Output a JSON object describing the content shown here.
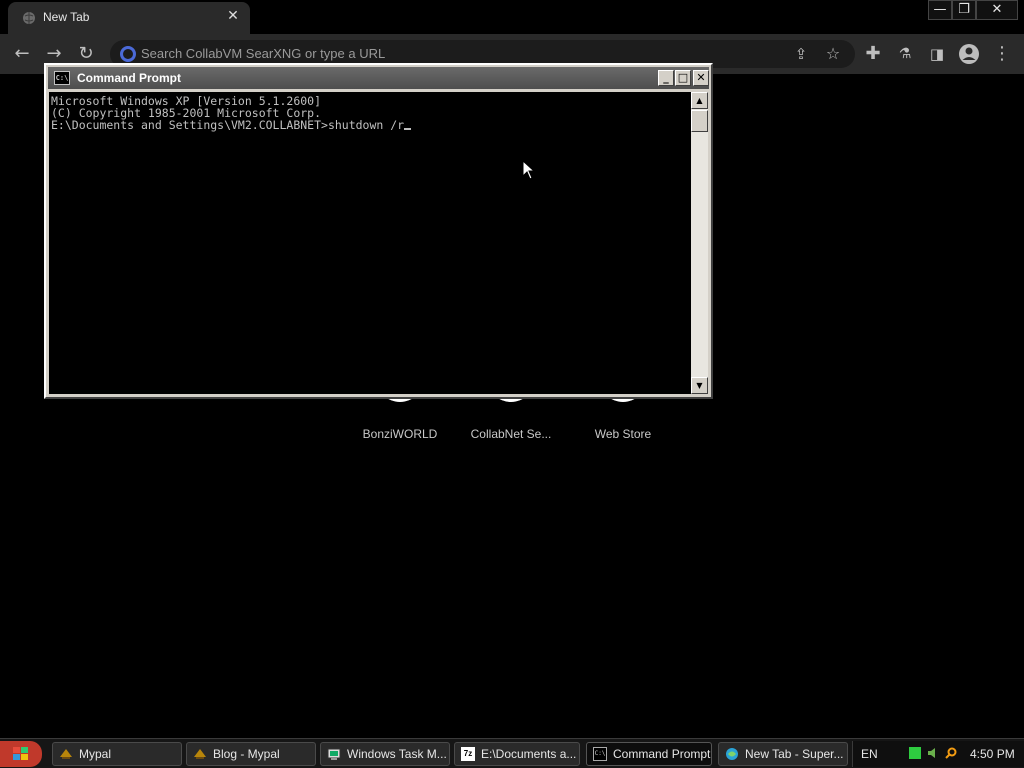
{
  "browser": {
    "tab_title": "New Tab",
    "omnibox_placeholder": "Search CollabVM SearXNG or type a URL"
  },
  "shortcuts": [
    {
      "label": "BonziWORLD"
    },
    {
      "label": "CollabNet Se..."
    },
    {
      "label": "Web Store"
    }
  ],
  "cmd": {
    "title": "Command Prompt",
    "icon_text": "C:\\",
    "lines": [
      "Microsoft Windows XP [Version 5.1.2600]",
      "(C) Copyright 1985-2001 Microsoft Corp.",
      "",
      "E:\\Documents and Settings\\VM2.COLLABNET>shutdown /r"
    ]
  },
  "taskbar": {
    "tasks": [
      {
        "label": "Mypal",
        "icon": "mypal-icon"
      },
      {
        "label": "Blog - Mypal",
        "icon": "mypal-icon"
      },
      {
        "label": "Windows Task M...",
        "icon": "task-manager-icon"
      },
      {
        "label": "E:\\Documents a...",
        "icon": "7zip-icon"
      },
      {
        "label": "Command Prompt",
        "icon": "cmd-icon"
      },
      {
        "label": "New Tab - Super...",
        "icon": "browser-icon"
      }
    ],
    "active_task": "Command Prompt",
    "language": "EN",
    "clock": "4:50 PM",
    "icon_7zip": "7z"
  },
  "colors": {
    "start_button": "#c0392b",
    "titlebar_inactive": "#5a5a5a",
    "console_bg": "#000000",
    "console_text": "#c0c0c0"
  }
}
